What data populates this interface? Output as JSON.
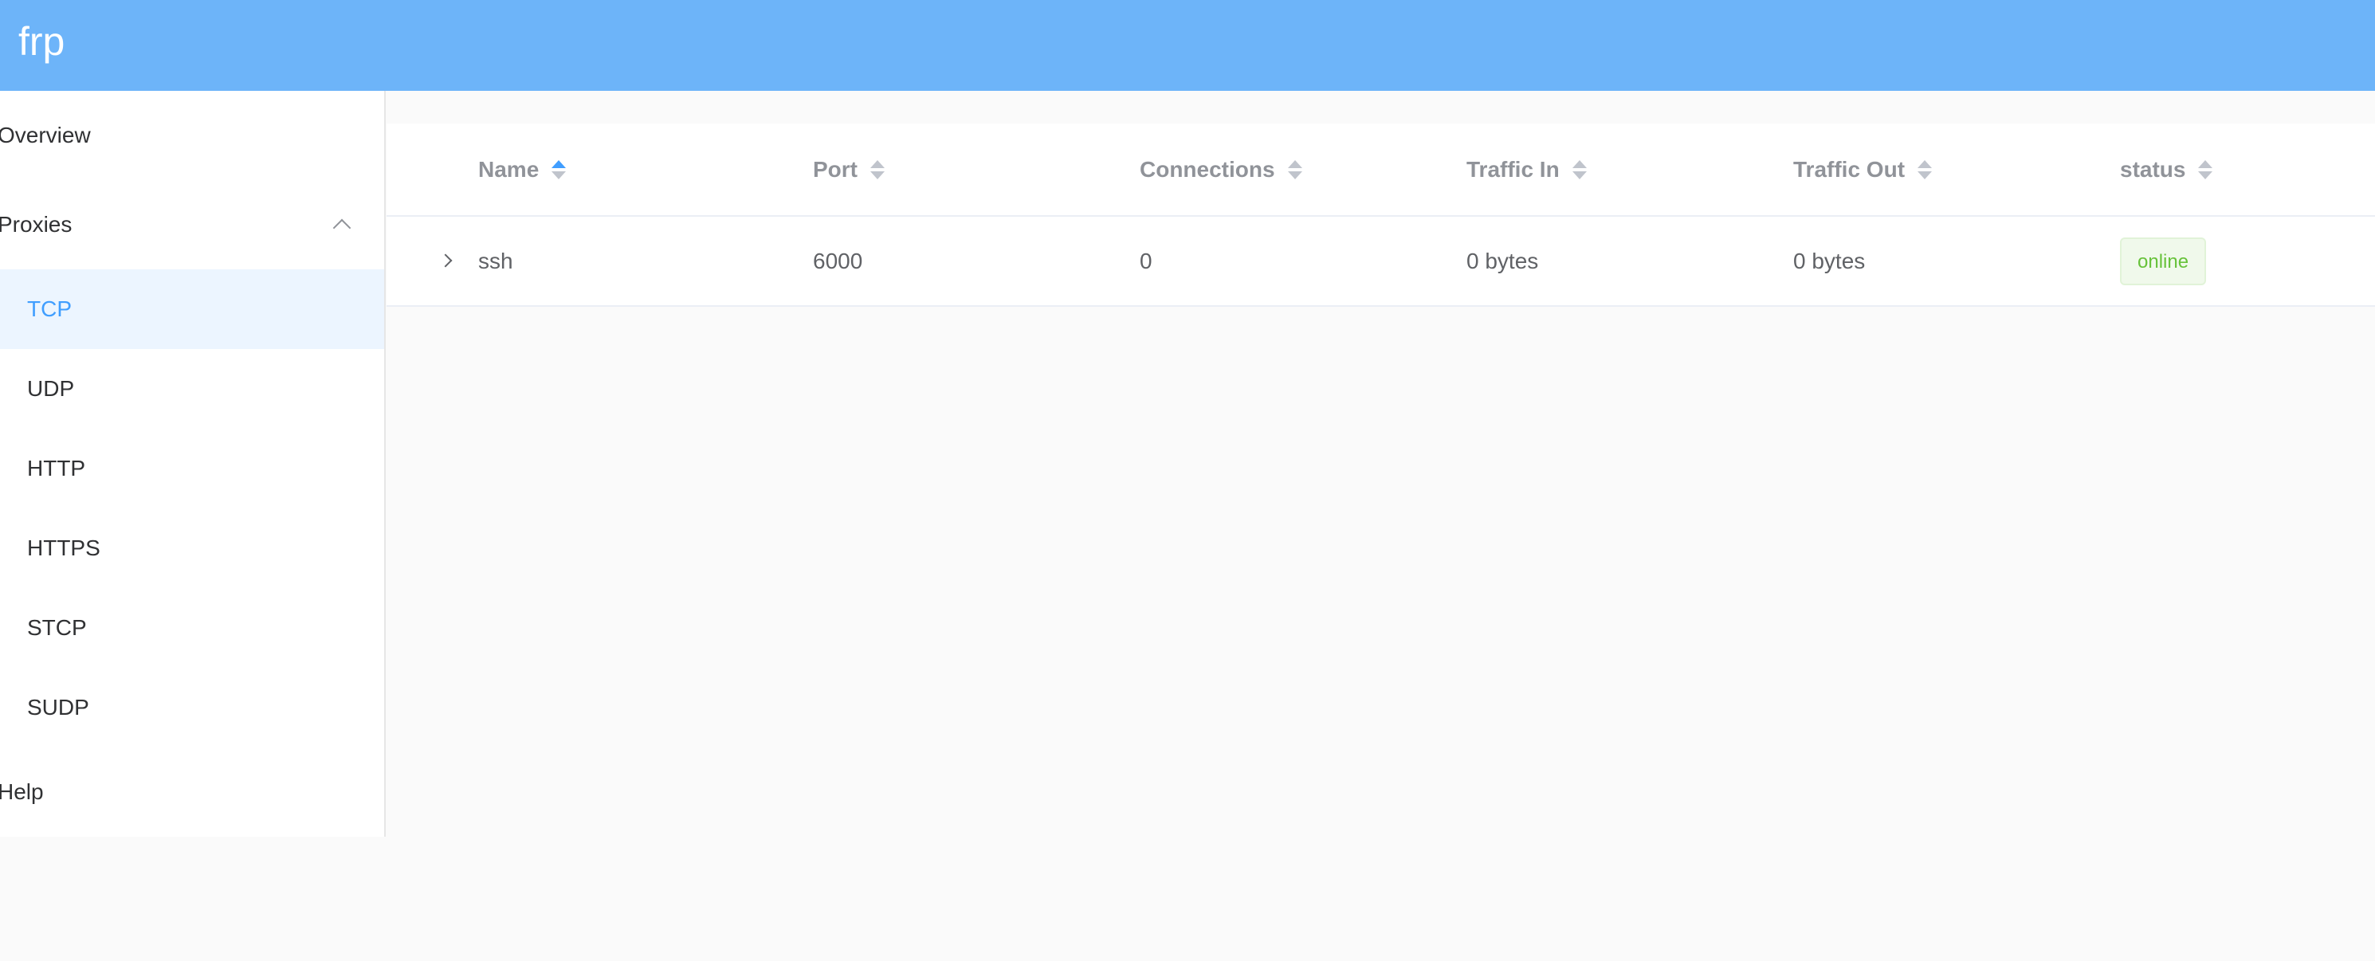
{
  "header": {
    "brand": "frp"
  },
  "sidebar": {
    "overview": "Overview",
    "proxies": "Proxies",
    "sub_items": [
      "TCP",
      "UDP",
      "HTTP",
      "HTTPS",
      "STCP",
      "SUDP"
    ],
    "active_sub": "TCP",
    "help": "Help"
  },
  "table": {
    "columns": [
      "Name",
      "Port",
      "Connections",
      "Traffic In",
      "Traffic Out",
      "status"
    ],
    "sorted_column": "Name",
    "sort_direction": "ascending",
    "rows": [
      {
        "name": "ssh",
        "port": "6000",
        "connections": "0",
        "traffic_in": "0 bytes",
        "traffic_out": "0 bytes",
        "status": "online"
      }
    ]
  },
  "colors": {
    "header_bg": "#6db4f9",
    "accent": "#409eff",
    "active_bg": "#ecf5ff",
    "status_online": "#67c23a"
  }
}
